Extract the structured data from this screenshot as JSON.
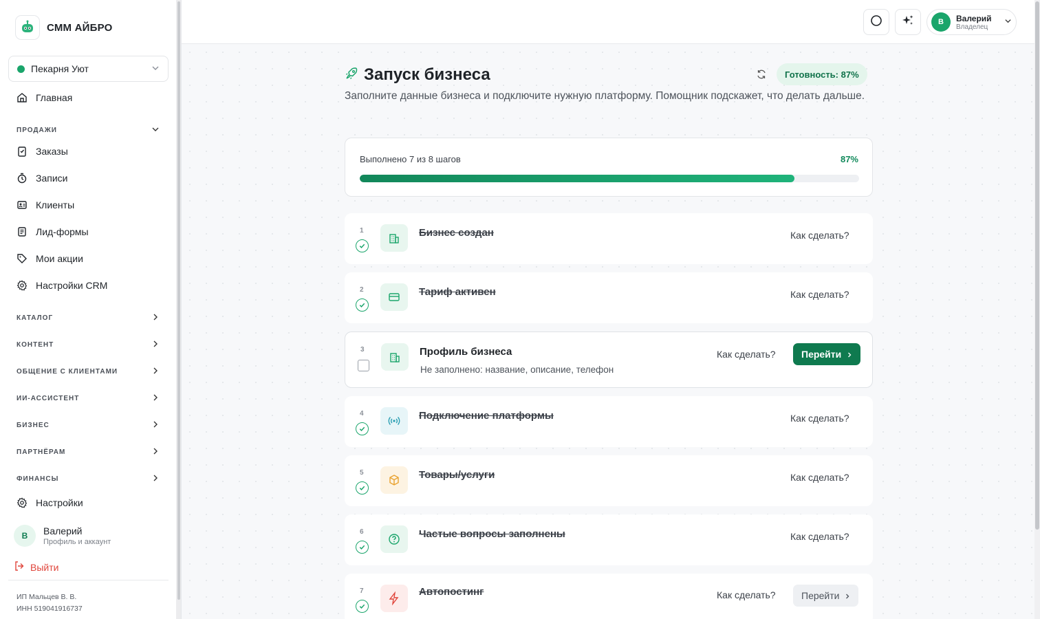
{
  "brand": {
    "name": "СММ АЙБРО"
  },
  "business": {
    "selected": "Пекарня Уют"
  },
  "nav": {
    "home": "Главная",
    "sales_section": "ПРОДАЖИ",
    "sales_items": [
      "Заказы",
      "Записи",
      "Клиенты",
      "Лид-формы",
      "Мои акции",
      "Настройки CRM"
    ],
    "sections": [
      "КАТАЛОГ",
      "КОНТЕНТ",
      "ОБЩЕНИЕ С КЛИЕНТАМИ",
      "ИИ-АССИСТЕНТ",
      "БИЗНЕС",
      "ПАРТНЁРАМ",
      "ФИНАНСЫ"
    ],
    "settings": "Настройки"
  },
  "sidebar_user": {
    "initial": "В",
    "name": "Валерий",
    "subtitle": "Профиль и аккаунт"
  },
  "logout_label": "Выйти",
  "legal": {
    "line1": "ИП Мальцев В. В.",
    "line2": "ИНН 519041916737"
  },
  "header": {
    "user_initial": "В",
    "user_name": "Валерий",
    "user_role": "Владелец"
  },
  "page": {
    "title": "Запуск бизнеса",
    "readiness": "Готовность: 87%",
    "subtitle": "Заполните данные бизнеса и подключите нужную платформу. Помощник подскажет, что делать дальше."
  },
  "progress": {
    "label": "Выполнено 7 из 8 шагов",
    "percent_text": "87%",
    "fraction": 0.87
  },
  "how_label": "Как сделать?",
  "go_label": "Перейти",
  "steps": [
    {
      "num": "1",
      "title": "Бизнес создан",
      "done": true,
      "icon": "building-icon"
    },
    {
      "num": "2",
      "title": "Тариф активен",
      "done": true,
      "icon": "card-icon"
    },
    {
      "num": "3",
      "title": "Профиль бизнеса",
      "done": false,
      "desc": "Не заполнено: название, описание, телефон",
      "icon": "building-icon"
    },
    {
      "num": "4",
      "title": "Подключение платформы",
      "done": true,
      "icon": "broadcast-icon"
    },
    {
      "num": "5",
      "title": "Товары/услуги",
      "done": true,
      "icon": "box-icon"
    },
    {
      "num": "6",
      "title": "Частые вопросы заполнены",
      "done": true,
      "icon": "question-icon"
    },
    {
      "num": "7",
      "title": "Автопостинг",
      "done": true,
      "icon": "lightning-icon"
    }
  ],
  "colors": {
    "accent": "#0f7a4f",
    "accent_light": "#1aa56b",
    "danger": "#e0453b"
  }
}
